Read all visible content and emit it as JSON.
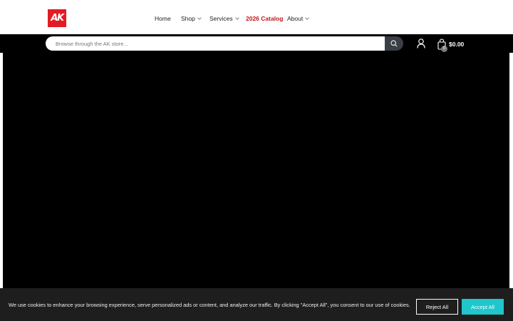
{
  "header": {
    "logo_text": "AK",
    "brand_color": "#e31b23",
    "nav": {
      "home": "Home",
      "shop": "Shop",
      "services": "Services",
      "catalog": "2026 Catalog",
      "about": "About"
    }
  },
  "search": {
    "placeholder": "Browse through the AK store...",
    "icon": "search-icon"
  },
  "account": {
    "icon": "user-icon"
  },
  "cart": {
    "icon": "shopping-bag-icon",
    "count": "0",
    "total": "$0.00"
  },
  "cookie_banner": {
    "message": "We use cookies to enhance your browsing experience, serve personalized ads or content, and analyze our traffic. By clicking \"Accept All\", you consent to our use of cookies.",
    "reject_label": "Reject All",
    "accept_label": "Accept All",
    "accept_color": "#1fc7cc"
  }
}
